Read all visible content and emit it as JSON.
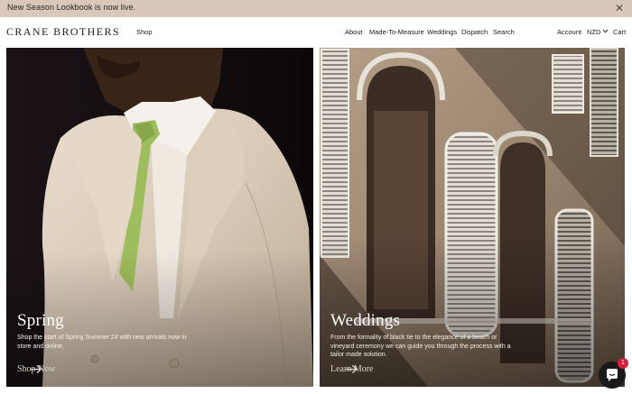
{
  "announcement": {
    "text": "New Season Lookbook is now live.",
    "close_icon": "close-icon"
  },
  "header": {
    "logo": "CRANE BROTHERS",
    "shop": "Shop",
    "nav": [
      "About",
      "Made-To-Measure",
      "Weddings",
      "Dispatch",
      "Search"
    ],
    "account": "Account",
    "currency": "NZD",
    "cart": "Cart"
  },
  "panels": [
    {
      "title": "Spring",
      "description": "Shop the start of Spring Summer 24 with new arrivals now in store and online.",
      "link": "Shop Now"
    },
    {
      "title": "Weddings",
      "description": "From the formality of black tie to the elegance of a beach or vineyard ceremony we can guide you through the process with a tailor made solution.",
      "link": "Learn More"
    }
  ],
  "chat": {
    "icon": "chat-icon",
    "badge": "1"
  },
  "colors": {
    "announcement_bg": "#d9c8b9",
    "badge": "#d61f3c"
  }
}
